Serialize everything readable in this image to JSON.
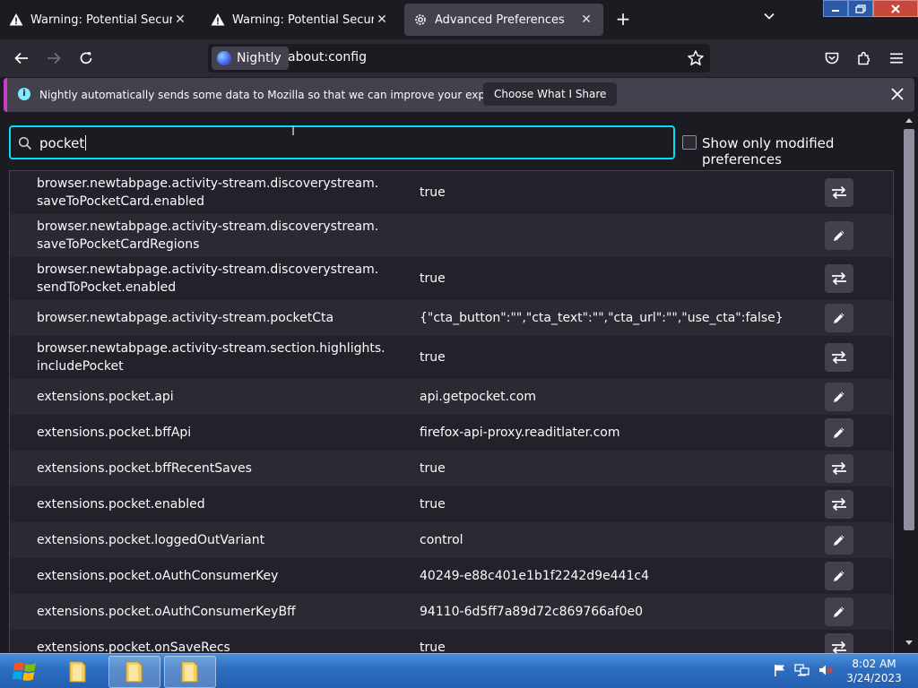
{
  "tabs": [
    {
      "title": "Warning: Potential Security Risk Ahead",
      "icon": "warning-icon",
      "selected": false
    },
    {
      "title": "Warning: Potential Security Risk Ahead",
      "icon": "warning-icon",
      "selected": false
    },
    {
      "title": "Advanced Preferences",
      "icon": "gear-icon",
      "selected": true
    }
  ],
  "toolbar": {
    "identity_label": "Nightly",
    "url": "about:config"
  },
  "notification": {
    "message": "Nightly automatically sends some data to Mozilla so that we can improve your experience.",
    "button_label": "Choose What I Share"
  },
  "search": {
    "value": "pocket"
  },
  "filter": {
    "label": "Show only modified preferences",
    "checked": false
  },
  "preferences": [
    {
      "name": "browser.newtabpage.activity-stream.discoverystream.\nsaveToPocketCard.enabled",
      "value": "true",
      "action": "toggle"
    },
    {
      "name": "browser.newtabpage.activity-stream.discoverystream.\nsaveToPocketCardRegions",
      "value": "",
      "action": "edit"
    },
    {
      "name": "browser.newtabpage.activity-stream.discoverystream.\nsendToPocket.enabled",
      "value": "true",
      "action": "toggle"
    },
    {
      "name": "browser.newtabpage.activity-stream.pocketCta",
      "value": "{\"cta_button\":\"\",\"cta_text\":\"\",\"cta_url\":\"\",\"use_cta\":false}",
      "action": "edit"
    },
    {
      "name": "browser.newtabpage.activity-stream.section.highlights.\nincludePocket",
      "value": "true",
      "action": "toggle"
    },
    {
      "name": "extensions.pocket.api",
      "value": "api.getpocket.com",
      "action": "edit"
    },
    {
      "name": "extensions.pocket.bffApi",
      "value": "firefox-api-proxy.readitlater.com",
      "action": "edit"
    },
    {
      "name": "extensions.pocket.bffRecentSaves",
      "value": "true",
      "action": "toggle"
    },
    {
      "name": "extensions.pocket.enabled",
      "value": "true",
      "action": "toggle"
    },
    {
      "name": "extensions.pocket.loggedOutVariant",
      "value": "control",
      "action": "edit"
    },
    {
      "name": "extensions.pocket.oAuthConsumerKey",
      "value": "40249-e88c401e1b1f2242d9e441c4",
      "action": "edit"
    },
    {
      "name": "extensions.pocket.oAuthConsumerKeyBff",
      "value": "94110-6d5ff7a89d72c869766af0e0",
      "action": "edit"
    },
    {
      "name": "extensions.pocket.onSaveRecs",
      "value": "true",
      "action": "toggle"
    }
  ],
  "taskbar": {
    "time": "8:02 AM",
    "date": "3/24/2023"
  }
}
